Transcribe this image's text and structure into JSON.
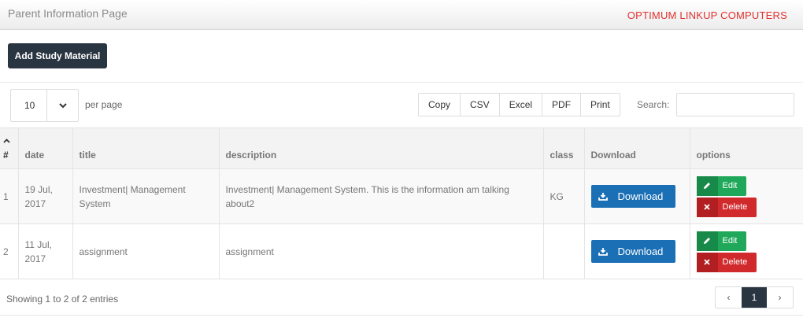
{
  "header": {
    "title": "Parent Information Page",
    "brand": "OPTIMUM LINKUP COMPUTERS"
  },
  "actions": {
    "add_label": "Add Study Material"
  },
  "length": {
    "value": "10",
    "suffix": "per page"
  },
  "export": {
    "copy": "Copy",
    "csv": "CSV",
    "excel": "Excel",
    "pdf": "PDF",
    "print": "Print"
  },
  "search": {
    "label": "Search:",
    "value": ""
  },
  "table": {
    "columns": [
      "#",
      "date",
      "title",
      "description",
      "class",
      "Download",
      "options"
    ],
    "rows": [
      {
        "num": "1",
        "date": "19 Jul, 2017",
        "title": "Investment| Management System",
        "description": "Investment| Management System. This is the information am talking about2",
        "class": "KG",
        "download": "Download",
        "edit": "Edit",
        "delete": "Delete"
      },
      {
        "num": "2",
        "date": "11 Jul, 2017",
        "title": "assignment",
        "description": "assignment",
        "class": "",
        "download": "Download",
        "edit": "Edit",
        "delete": "Delete"
      }
    ]
  },
  "footer": {
    "info": "Showing 1 to 2 of 2 entries",
    "prev": "‹",
    "page": "1",
    "next": "›"
  },
  "colors": {
    "primary_dark": "#2a3542",
    "download_blue": "#1a6fb5",
    "edit_green": "#1fa85a",
    "delete_red": "#d12a2c",
    "brand_red": "#e0312f"
  },
  "icons": {
    "sort": "sort-asc-icon",
    "caret": "chevron-down-icon",
    "download": "download-icon",
    "edit": "pencil-icon",
    "delete": "close-icon"
  }
}
